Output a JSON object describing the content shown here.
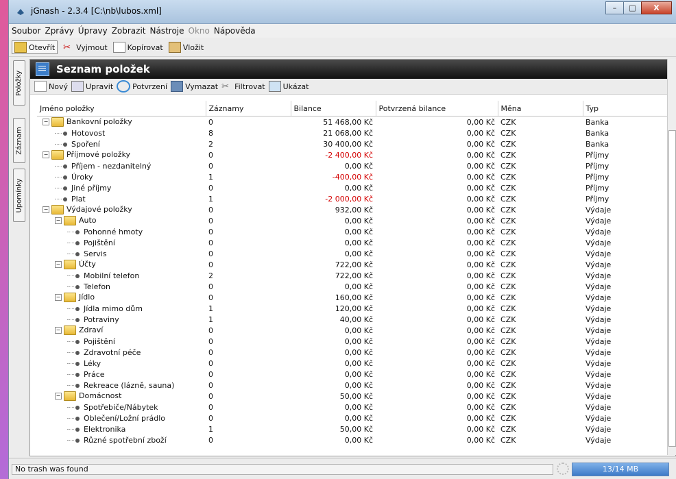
{
  "window": {
    "title": "jGnash - 2.3.4  [C:\\nb\\lubos.xml]"
  },
  "menu": [
    "Soubor",
    "Zprávy",
    "Úpravy",
    "Zobrazit",
    "Nástroje",
    "Okno",
    "Nápověda"
  ],
  "toolbar": {
    "open": "Otevřít",
    "cut": "Vyjmout",
    "copy": "Kopírovat",
    "paste": "Vložit"
  },
  "sidetabs": [
    "Položky",
    "Záznam",
    "Upomínky"
  ],
  "panel": {
    "title": "Seznam položek"
  },
  "panel_toolbar": {
    "new": "Nový",
    "edit": "Upravit",
    "confirm": "Potvrzení",
    "delete": "Vymazat",
    "filter": "Filtrovat",
    "show": "Ukázat"
  },
  "columns": [
    "Jméno položky",
    "Záznamy",
    "Bilance",
    "Potvrzená bilance",
    "Měna",
    "Typ"
  ],
  "rows": [
    {
      "name": "Bankovní položky",
      "level": 0,
      "group": true,
      "records": "0",
      "balance": "51 468,00 Kč",
      "confirmed": "0,00 Kč",
      "currency": "CZK",
      "type": "Banka",
      "neg": false
    },
    {
      "name": "Hotovost",
      "level": 1,
      "group": false,
      "records": "8",
      "balance": "21 068,00 Kč",
      "confirmed": "0,00 Kč",
      "currency": "CZK",
      "type": "Banka",
      "neg": false
    },
    {
      "name": "Spoření",
      "level": 1,
      "group": false,
      "records": "2",
      "balance": "30 400,00 Kč",
      "confirmed": "0,00 Kč",
      "currency": "CZK",
      "type": "Banka",
      "neg": false
    },
    {
      "name": "Příjmové položky",
      "level": 0,
      "group": true,
      "records": "0",
      "balance": "-2 400,00 Kč",
      "confirmed": "0,00 Kč",
      "currency": "CZK",
      "type": "Příjmy",
      "neg": true
    },
    {
      "name": "Příjem - nezdanitelný",
      "level": 1,
      "group": false,
      "records": "0",
      "balance": "0,00 Kč",
      "confirmed": "0,00 Kč",
      "currency": "CZK",
      "type": "Příjmy",
      "neg": false
    },
    {
      "name": "Úroky",
      "level": 1,
      "group": false,
      "records": "1",
      "balance": "-400,00 Kč",
      "confirmed": "0,00 Kč",
      "currency": "CZK",
      "type": "Příjmy",
      "neg": true
    },
    {
      "name": "Jiné příjmy",
      "level": 1,
      "group": false,
      "records": "0",
      "balance": "0,00 Kč",
      "confirmed": "0,00 Kč",
      "currency": "CZK",
      "type": "Příjmy",
      "neg": false
    },
    {
      "name": "Plat",
      "level": 1,
      "group": false,
      "records": "1",
      "balance": "-2 000,00 Kč",
      "confirmed": "0,00 Kč",
      "currency": "CZK",
      "type": "Příjmy",
      "neg": true
    },
    {
      "name": "Výdajové položky",
      "level": 0,
      "group": true,
      "records": "0",
      "balance": "932,00 Kč",
      "confirmed": "0,00 Kč",
      "currency": "CZK",
      "type": "Výdaje",
      "neg": false
    },
    {
      "name": "Auto",
      "level": 1,
      "group": true,
      "records": "0",
      "balance": "0,00 Kč",
      "confirmed": "0,00 Kč",
      "currency": "CZK",
      "type": "Výdaje",
      "neg": false
    },
    {
      "name": "Pohonné hmoty",
      "level": 2,
      "group": false,
      "records": "0",
      "balance": "0,00 Kč",
      "confirmed": "0,00 Kč",
      "currency": "CZK",
      "type": "Výdaje",
      "neg": false
    },
    {
      "name": "Pojištění",
      "level": 2,
      "group": false,
      "records": "0",
      "balance": "0,00 Kč",
      "confirmed": "0,00 Kč",
      "currency": "CZK",
      "type": "Výdaje",
      "neg": false
    },
    {
      "name": "Servis",
      "level": 2,
      "group": false,
      "records": "0",
      "balance": "0,00 Kč",
      "confirmed": "0,00 Kč",
      "currency": "CZK",
      "type": "Výdaje",
      "neg": false
    },
    {
      "name": "Účty",
      "level": 1,
      "group": true,
      "records": "0",
      "balance": "722,00 Kč",
      "confirmed": "0,00 Kč",
      "currency": "CZK",
      "type": "Výdaje",
      "neg": false
    },
    {
      "name": "Mobilní telefon",
      "level": 2,
      "group": false,
      "records": "2",
      "balance": "722,00 Kč",
      "confirmed": "0,00 Kč",
      "currency": "CZK",
      "type": "Výdaje",
      "neg": false
    },
    {
      "name": "Telefon",
      "level": 2,
      "group": false,
      "records": "0",
      "balance": "0,00 Kč",
      "confirmed": "0,00 Kč",
      "currency": "CZK",
      "type": "Výdaje",
      "neg": false
    },
    {
      "name": "Jídlo",
      "level": 1,
      "group": true,
      "records": "0",
      "balance": "160,00 Kč",
      "confirmed": "0,00 Kč",
      "currency": "CZK",
      "type": "Výdaje",
      "neg": false
    },
    {
      "name": "Jídla mimo dům",
      "level": 2,
      "group": false,
      "records": "1",
      "balance": "120,00 Kč",
      "confirmed": "0,00 Kč",
      "currency": "CZK",
      "type": "Výdaje",
      "neg": false
    },
    {
      "name": "Potraviny",
      "level": 2,
      "group": false,
      "records": "1",
      "balance": "40,00 Kč",
      "confirmed": "0,00 Kč",
      "currency": "CZK",
      "type": "Výdaje",
      "neg": false
    },
    {
      "name": "Zdraví",
      "level": 1,
      "group": true,
      "records": "0",
      "balance": "0,00 Kč",
      "confirmed": "0,00 Kč",
      "currency": "CZK",
      "type": "Výdaje",
      "neg": false
    },
    {
      "name": "Pojištění",
      "level": 2,
      "group": false,
      "records": "0",
      "balance": "0,00 Kč",
      "confirmed": "0,00 Kč",
      "currency": "CZK",
      "type": "Výdaje",
      "neg": false
    },
    {
      "name": "Zdravotní péče",
      "level": 2,
      "group": false,
      "records": "0",
      "balance": "0,00 Kč",
      "confirmed": "0,00 Kč",
      "currency": "CZK",
      "type": "Výdaje",
      "neg": false
    },
    {
      "name": "Léky",
      "level": 2,
      "group": false,
      "records": "0",
      "balance": "0,00 Kč",
      "confirmed": "0,00 Kč",
      "currency": "CZK",
      "type": "Výdaje",
      "neg": false
    },
    {
      "name": "Práce",
      "level": 2,
      "group": false,
      "records": "0",
      "balance": "0,00 Kč",
      "confirmed": "0,00 Kč",
      "currency": "CZK",
      "type": "Výdaje",
      "neg": false
    },
    {
      "name": "Rekreace (lázně, sauna)",
      "level": 2,
      "group": false,
      "records": "0",
      "balance": "0,00 Kč",
      "confirmed": "0,00 Kč",
      "currency": "CZK",
      "type": "Výdaje",
      "neg": false
    },
    {
      "name": "Domácnost",
      "level": 1,
      "group": true,
      "records": "0",
      "balance": "50,00 Kč",
      "confirmed": "0,00 Kč",
      "currency": "CZK",
      "type": "Výdaje",
      "neg": false
    },
    {
      "name": "Spotřebiče/Nábytek",
      "level": 2,
      "group": false,
      "records": "0",
      "balance": "0,00 Kč",
      "confirmed": "0,00 Kč",
      "currency": "CZK",
      "type": "Výdaje",
      "neg": false
    },
    {
      "name": "Oblečení/Ložní prádlo",
      "level": 2,
      "group": false,
      "records": "0",
      "balance": "0,00 Kč",
      "confirmed": "0,00 Kč",
      "currency": "CZK",
      "type": "Výdaje",
      "neg": false
    },
    {
      "name": "Elektronika",
      "level": 2,
      "group": false,
      "records": "1",
      "balance": "50,00 Kč",
      "confirmed": "0,00 Kč",
      "currency": "CZK",
      "type": "Výdaje",
      "neg": false
    },
    {
      "name": "Různé spotřební zboží",
      "level": 2,
      "group": false,
      "records": "0",
      "balance": "0,00 Kč",
      "confirmed": "0,00 Kč",
      "currency": "CZK",
      "type": "Výdaje",
      "neg": false
    }
  ],
  "status": {
    "message": "No trash was found",
    "memory": "13/14 MB"
  }
}
